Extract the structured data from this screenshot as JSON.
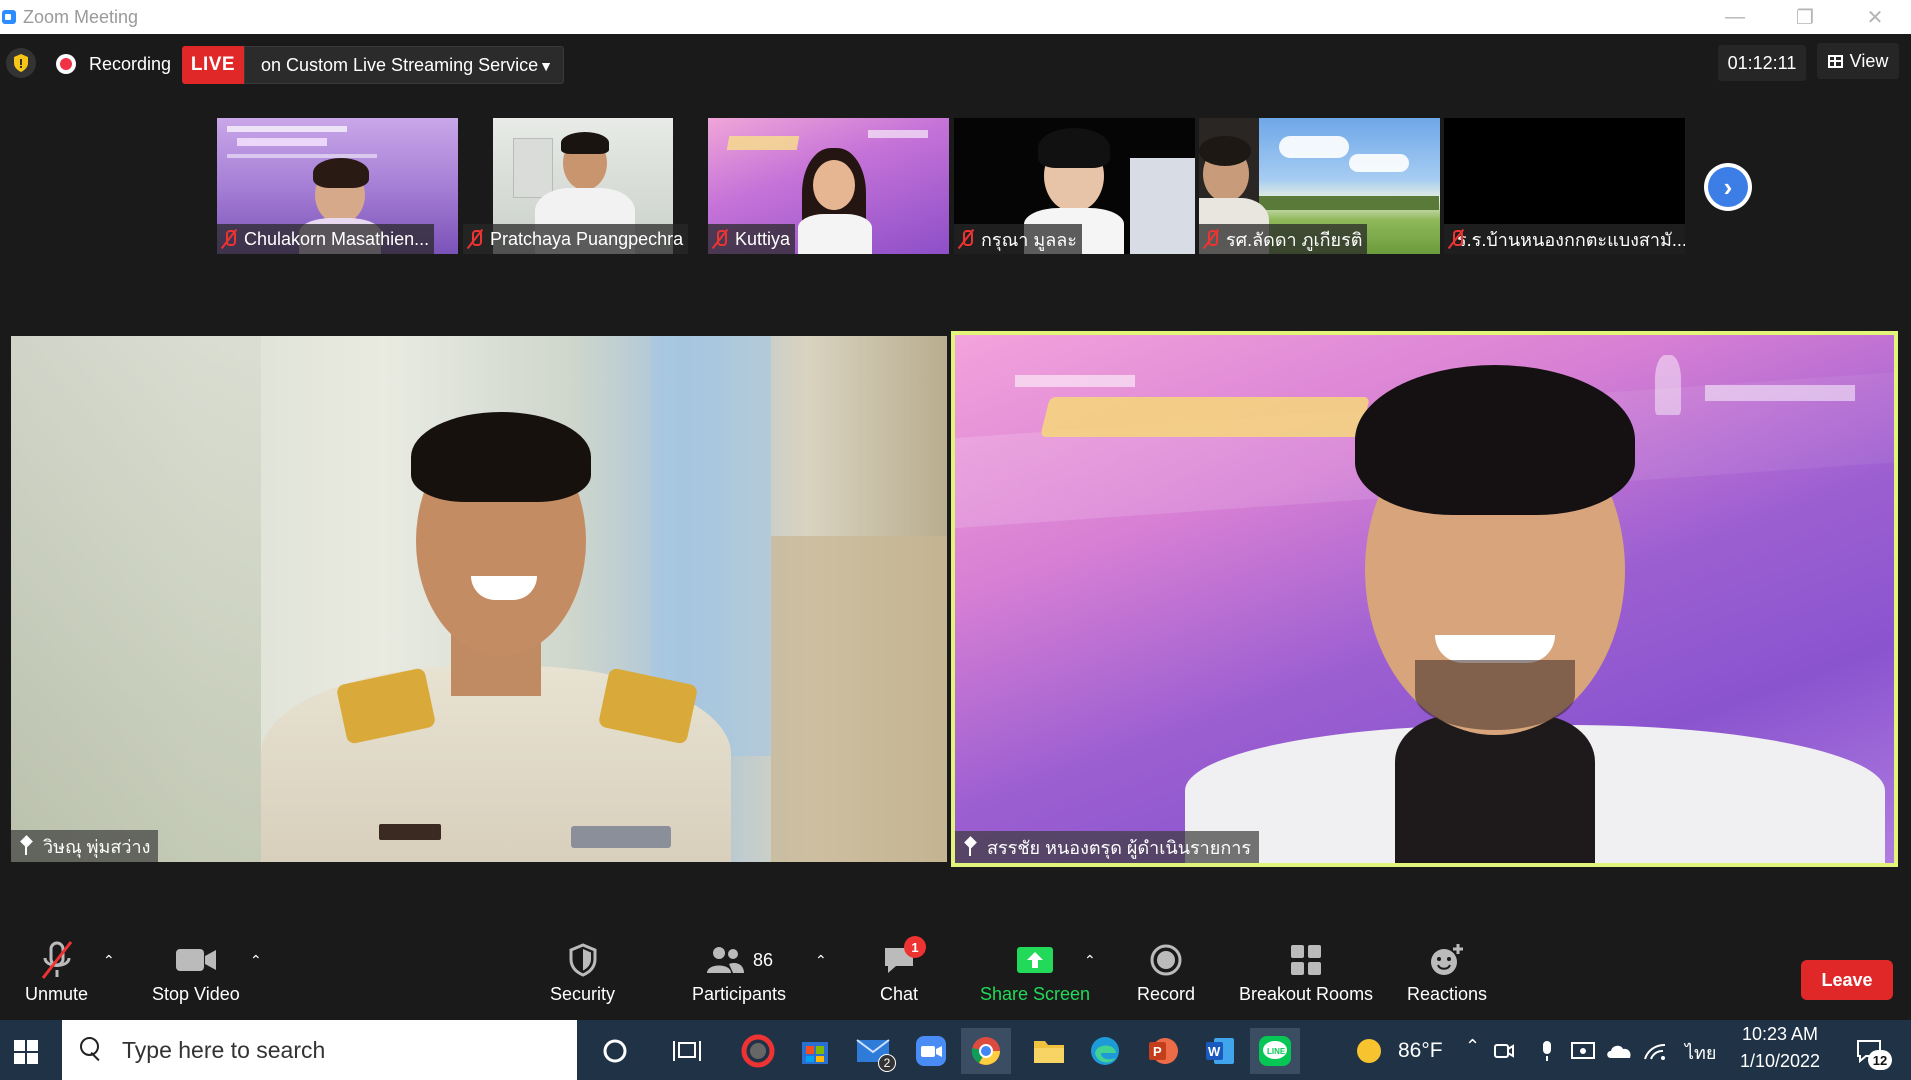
{
  "window": {
    "title": "Zoom Meeting"
  },
  "topbar": {
    "recording_label": "Recording",
    "live_label": "LIVE",
    "stream_label": "on Custom Live Streaming Service",
    "timer": "01:12:11",
    "view_label": "View"
  },
  "thumbnails": [
    {
      "name": "Chulakorn Masathien..."
    },
    {
      "name": "Pratchaya Puangpechra"
    },
    {
      "name": "Kuttiya"
    },
    {
      "name": "กรุณา มูลละ"
    },
    {
      "name": "รศ.ลัดดา ภูเกียรติ"
    },
    {
      "name": "ร.ร.บ้านหนองกกตะแบงสามั..."
    }
  ],
  "main": {
    "left_name": "วิษณุ พุ่มสว่าง",
    "right_name": "สรรชัย หนองตรุด ผู้ดำเนินรายการ"
  },
  "toolbar": {
    "unmute": "Unmute",
    "stop_video": "Stop Video",
    "security": "Security",
    "participants_count": "86",
    "participants": "Participants",
    "chat_badge": "1",
    "chat": "Chat",
    "share_screen": "Share Screen",
    "record": "Record",
    "breakout_rooms": "Breakout Rooms",
    "reactions": "Reactions",
    "leave": "Leave",
    "share_color": "#23d959",
    "leave_color": "#e02828"
  },
  "taskbar": {
    "search_placeholder": "Type here to search",
    "mail_badge": "2",
    "weather": "86°F",
    "language": "ไทย",
    "time": "10:23 AM",
    "date": "1/10/2022",
    "notification_count": "12"
  }
}
